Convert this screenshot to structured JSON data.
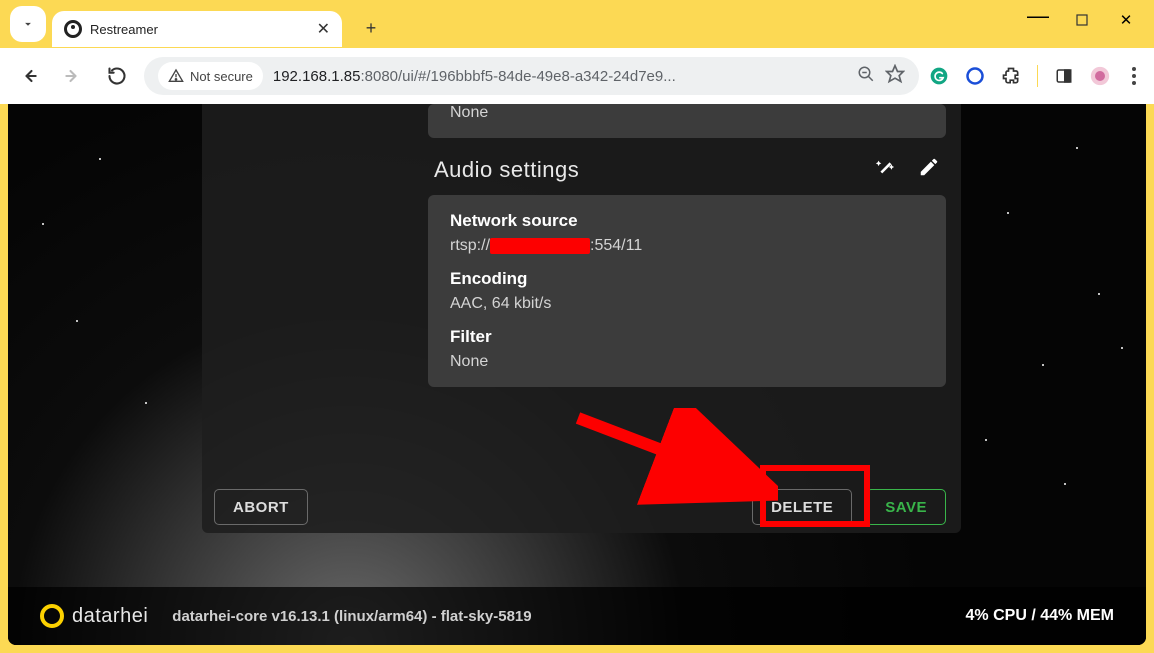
{
  "browser": {
    "tab_title": "Restreamer",
    "not_secure": "Not secure",
    "url_host": "192.168.1.85",
    "url_port": ":8080",
    "url_path": "/ui/#/196bbbf5-84de-49e8-a342-24d7e9..."
  },
  "video_filter": {
    "value": "None"
  },
  "audio": {
    "section_title": "Audio settings",
    "source_heading": "Network source",
    "source_prefix": "rtsp://",
    "source_suffix": ":554/11",
    "encoding_heading": "Encoding",
    "encoding_value": "AAC, 64 kbit/s",
    "filter_heading": "Filter",
    "filter_value": "None"
  },
  "buttons": {
    "abort": "ABORT",
    "delete": "DELETE",
    "save": "SAVE"
  },
  "footer": {
    "brand": "datarhei",
    "core": "datarhei-core v16.13.1 (linux/arm64) - flat-sky-5819",
    "stats": "4% CPU / 44% MEM"
  }
}
